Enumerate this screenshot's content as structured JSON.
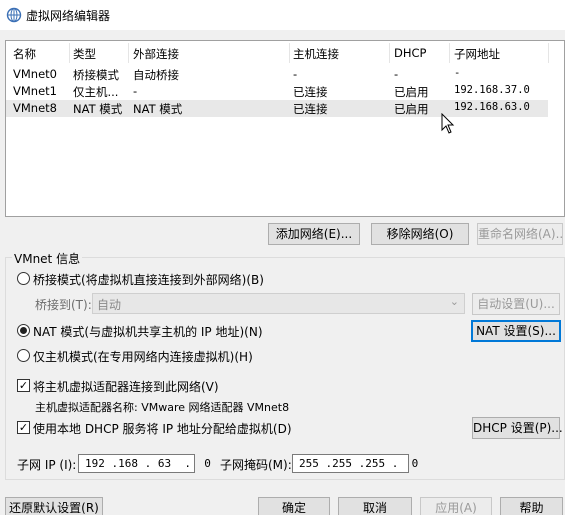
{
  "window": {
    "title": "虚拟网络编辑器",
    "icon": "vmware-network-icon"
  },
  "table": {
    "headers": [
      "名称",
      "类型",
      "外部连接",
      "主机连接",
      "DHCP",
      "子网地址"
    ],
    "rows": [
      [
        "VMnet0",
        "桥接模式",
        "自动桥接",
        "-",
        "-",
        "-"
      ],
      [
        "VMnet1",
        "仅主机...",
        "-",
        "已连接",
        "已启用",
        "192.168.37.0"
      ],
      [
        "VMnet8",
        "NAT 模式",
        "NAT 模式",
        "已连接",
        "已启用",
        "192.168.63.0"
      ]
    ],
    "selected_row": 2
  },
  "table_buttons": {
    "add": "添加网络(E)...",
    "remove": "移除网络(O)",
    "rename": "重命名网络(A)..."
  },
  "vmnet_info": {
    "group_label": "VMnet 信息",
    "bridged_label": "桥接模式(将虚拟机直接连接到外部网络)(B)",
    "bridged_to_label": "桥接到(T):",
    "bridged_to_value": "自动",
    "auto_settings": "自动设置(U)...",
    "nat_label": "NAT 模式(与虚拟机共享主机的 IP 地址)(N)",
    "nat_settings": "NAT 设置(S)...",
    "hostonly_label": "仅主机模式(在专用网络内连接虚拟机)(H)",
    "selected_mode": "nat",
    "connect_adapter_label": "将主机虚拟适配器连接到此网络(V)",
    "connect_adapter_checked": true,
    "adapter_name_label": "主机虚拟适配器名称: VMware 网络适配器 VMnet8",
    "dhcp_label": "使用本地 DHCP 服务将 IP 地址分配给虚拟机(D)",
    "dhcp_checked": true,
    "dhcp_settings": "DHCP 设置(P)...",
    "subnet_ip_label": "子网 IP (I):",
    "subnet_ip_value": "192 .168 . 63  .  0",
    "subnet_mask_label": "子网掩码(M):",
    "subnet_mask_value": "255 .255 .255 .  0"
  },
  "footer": {
    "restore_defaults": "还原默认设置(R)",
    "ok": "确定",
    "cancel": "取消",
    "apply": "应用(A)",
    "help": "帮助"
  }
}
